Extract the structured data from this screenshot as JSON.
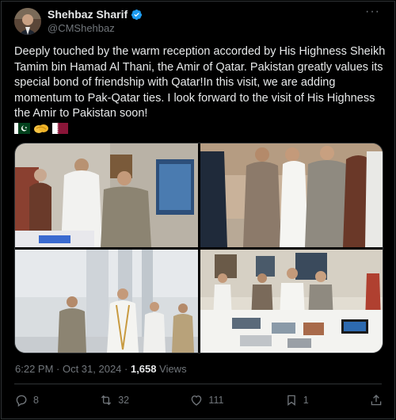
{
  "post": {
    "author_name": "Shehbaz Sharif",
    "handle": "@CMShehbaz",
    "more": "···",
    "text": "Deeply touched by the warm reception accorded by His Highness Sheikh Tamim bin Hamad Al Thani, the Amir of Qatar. Pakistan greatly values its special bond of friendship with Qatar!In this visit, we are adding momentum to Pak-Qatar ties. I look forward to the visit of His Highness the Amir to Pakistan soon!",
    "emojis": [
      "pakistan-flag-icon",
      "handshake-icon",
      "qatar-flag-icon"
    ],
    "time": "6:22 PM · Oct 31, 2024 · ",
    "views_count": "1,658",
    "views_label": " Views"
  },
  "actions": {
    "replies": "8",
    "reposts": "32",
    "likes": "111",
    "bookmarks": "1"
  },
  "colors": {
    "background": "#000000",
    "text": "#e7e9ea",
    "muted": "#71767b",
    "border": "#2f3336",
    "verified": "#1d9bf0"
  }
}
